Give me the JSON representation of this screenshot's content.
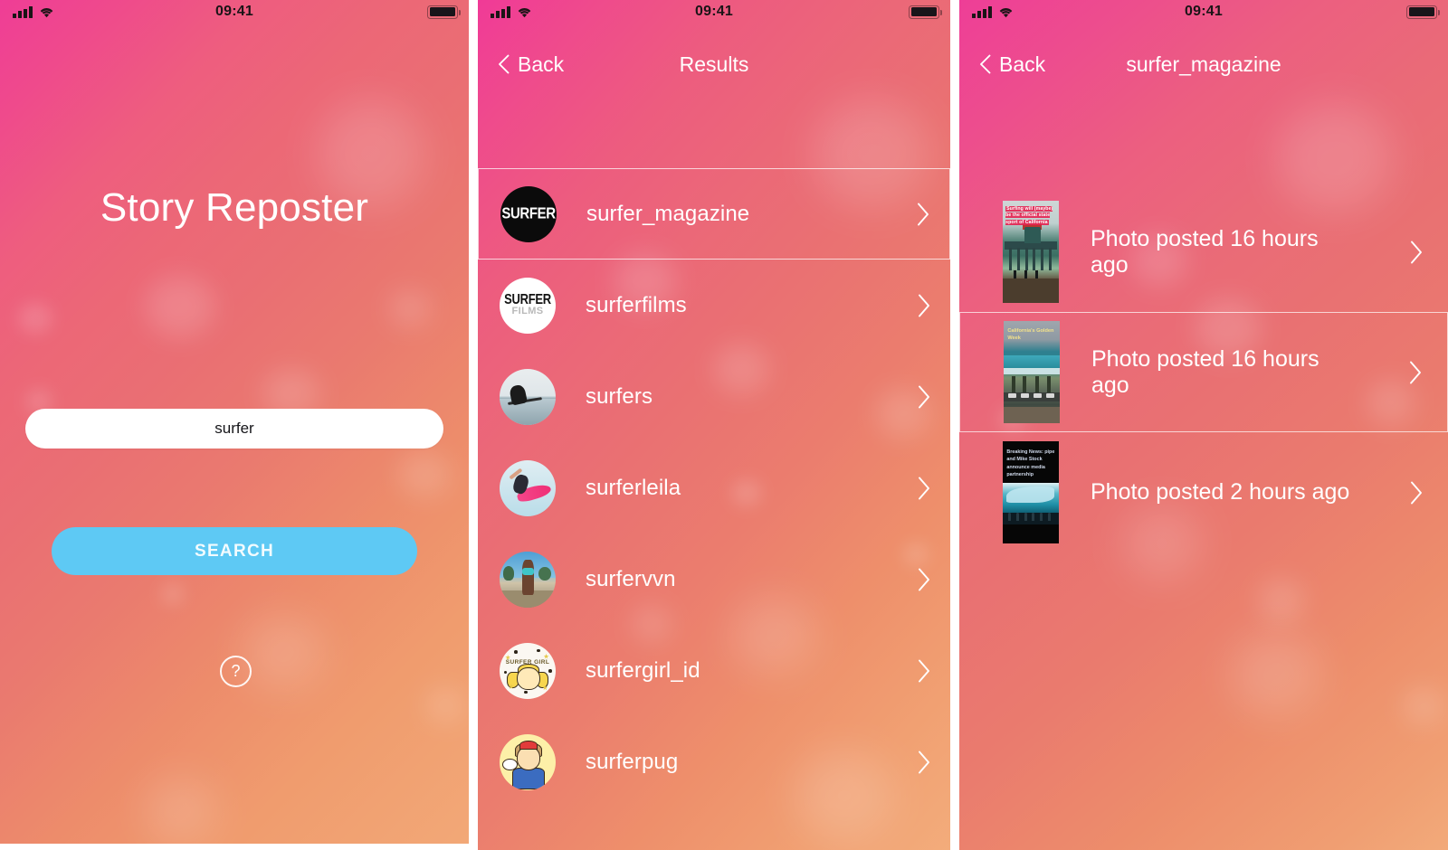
{
  "status_bar": {
    "time": "09:41",
    "signal_icon": "cellular-bars-icon",
    "wifi_icon": "wifi-icon",
    "battery_icon": "battery-full-icon"
  },
  "screen1": {
    "title": "Story Reposter",
    "search_input": {
      "value": "surfer",
      "placeholder": ""
    },
    "search_button": "SEARCH",
    "help_button": "?"
  },
  "screen2": {
    "back_label": "Back",
    "title": "Results",
    "results": [
      {
        "username": "surfer_magazine",
        "avatar": "surfer-magazine-logo",
        "selected": true
      },
      {
        "username": "surferfilms",
        "avatar": "surfer-films-logo",
        "selected": false
      },
      {
        "username": "surfers",
        "avatar": "surfers-photo",
        "selected": false
      },
      {
        "username": "surferleila",
        "avatar": "surferleila-photo",
        "selected": false
      },
      {
        "username": "surfervvn",
        "avatar": "surfervvn-photo",
        "selected": false
      },
      {
        "username": "surfergirl_id",
        "avatar": "surfergirl-illustration",
        "selected": false
      },
      {
        "username": "surferpug",
        "avatar": "surferpug-illustration",
        "selected": false
      }
    ]
  },
  "screen3": {
    "back_label": "Back",
    "title": "surfer_magazine",
    "stories": [
      {
        "label": "Photo posted 16 hours ago",
        "thumb_text": "Surfing will (maybe) be the official state sport of California",
        "selected": false
      },
      {
        "label": "Photo posted 16 hours ago",
        "thumb_text": "California's Golden Week",
        "selected": true
      },
      {
        "label": "Photo posted 2 hours ago",
        "thumb_text": "Breaking News: pipe and Mike Stock announce media partnership",
        "selected": false
      }
    ]
  },
  "colors": {
    "gradient_start": "#ef3d96",
    "gradient_end": "#f2a877",
    "button_blue": "#5ec9f4",
    "text_white": "#ffffff",
    "input_background": "#ffffff"
  }
}
